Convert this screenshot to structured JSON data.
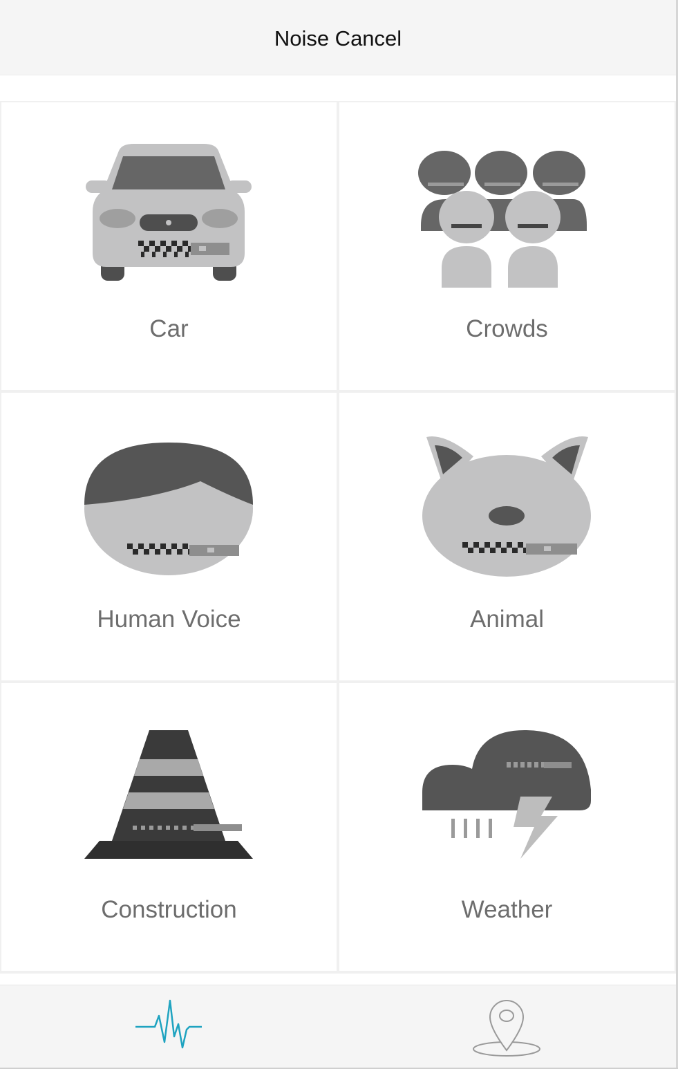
{
  "header": {
    "title": "Noise Cancel"
  },
  "categories": [
    {
      "label": "Car",
      "icon": "car-icon"
    },
    {
      "label": "Crowds",
      "icon": "crowds-icon"
    },
    {
      "label": "Human Voice",
      "icon": "human-voice-icon"
    },
    {
      "label": "Animal",
      "icon": "animal-icon"
    },
    {
      "label": "Construction",
      "icon": "construction-cone-icon"
    },
    {
      "label": "Weather",
      "icon": "weather-storm-icon"
    }
  ],
  "tabbar": {
    "tabs": [
      {
        "icon": "waveform-icon",
        "active": true,
        "color": "#1ea3c0"
      },
      {
        "icon": "location-pin-icon",
        "active": false,
        "color": "#9a9a9a"
      }
    ]
  },
  "colors": {
    "dark": "#5a5a5a",
    "light": "#c2c2c3",
    "accent": "#1ea3c0"
  }
}
